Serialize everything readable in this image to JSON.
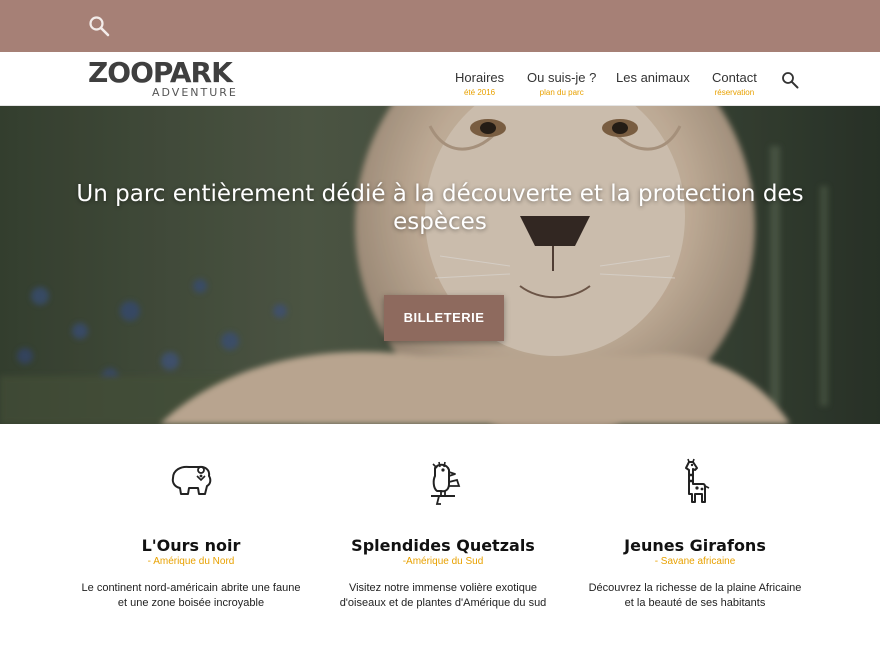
{
  "header": {
    "search_icon": "search-icon",
    "logo": {
      "main": "ZOOPARK",
      "sub": "ADVENTURE"
    },
    "nav": [
      {
        "label": "Horaires",
        "sub": "été 2016"
      },
      {
        "label": "Ou suis-je ?",
        "sub": "plan du parc"
      },
      {
        "label": "Les animaux",
        "sub": ""
      },
      {
        "label": "Contact",
        "sub": "réservation"
      }
    ]
  },
  "hero": {
    "title": "Un parc entièrement dédié à la découverte et la protection des espèces",
    "button": "BILLETERIE"
  },
  "cards": [
    {
      "icon": "bear-icon",
      "title": "L'Ours noir",
      "region": "- Amérique du Nord",
      "description": "Le continent nord-américain abrite une faune et une zone boisée incroyable"
    },
    {
      "icon": "quetzal-icon",
      "title": "Splendides Quetzals",
      "region": "-Amérique du Sud",
      "description": "Visitez notre immense volière exotique d'oiseaux et de plantes d'Amérique du sud"
    },
    {
      "icon": "giraffe-icon",
      "title": "Jeunes Girafons",
      "region": "- Savane africaine",
      "description": "Découvrez la richesse de la plaine Africaine et la beauté de ses habitants"
    }
  ],
  "colors": {
    "topbar": "#a68076",
    "accent": "#e8a100",
    "button": "#8e6a5e"
  }
}
